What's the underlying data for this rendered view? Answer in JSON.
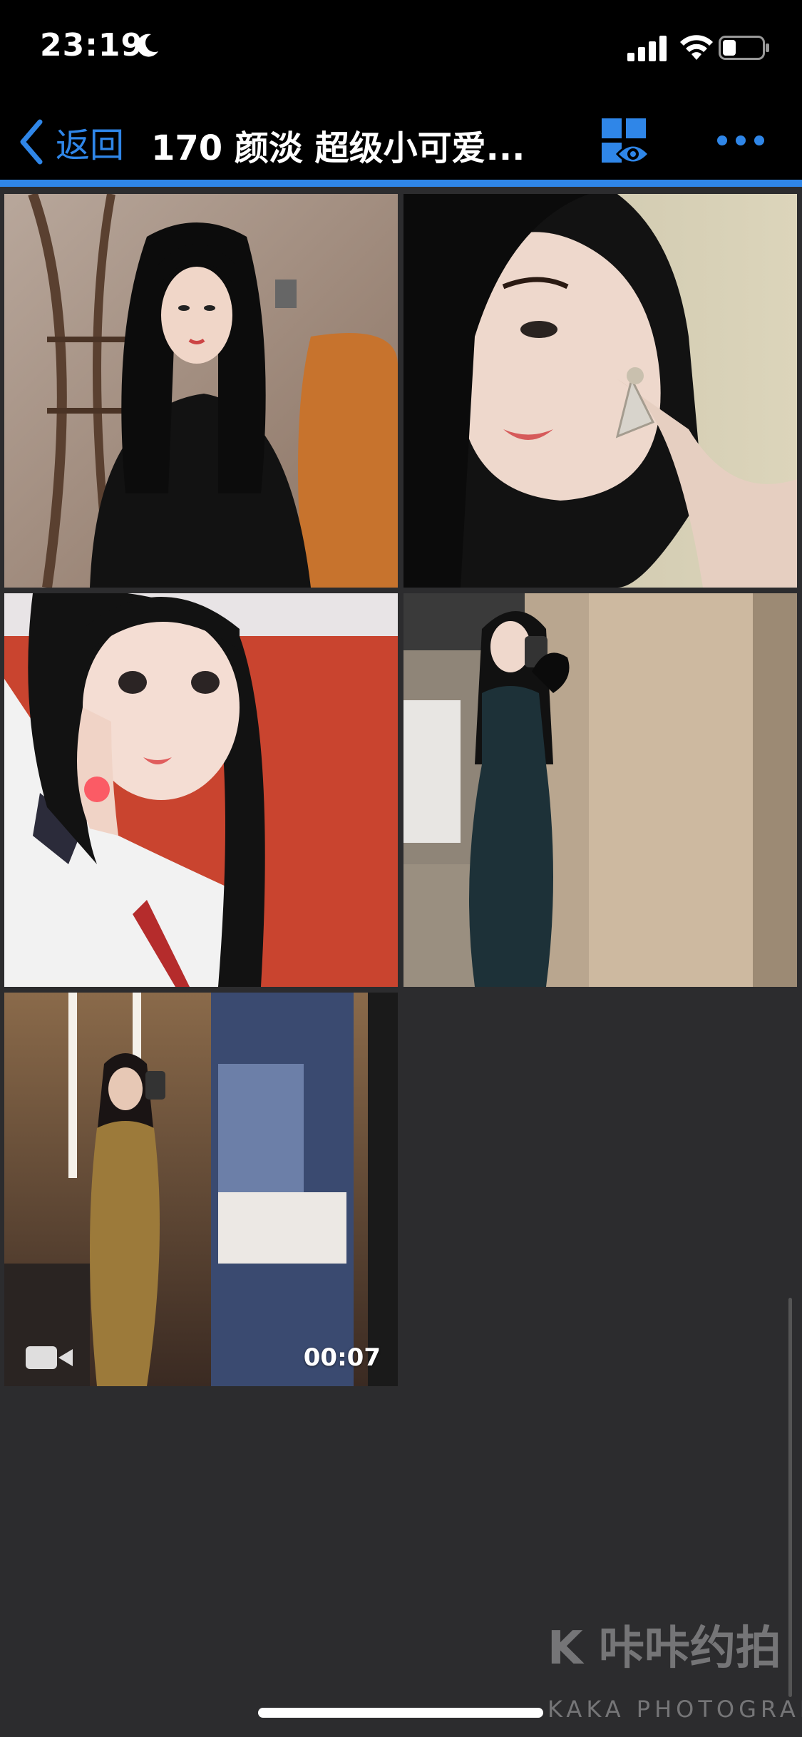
{
  "status_bar": {
    "time": "23:19",
    "icons": [
      "moon-icon",
      "signal-icon",
      "wifi-icon",
      "battery-icon"
    ]
  },
  "nav": {
    "back_label": "返回",
    "title": "170 颜淡 超级小可爱...",
    "icons": [
      "chevron-left-icon",
      "grid-eye-icon",
      "more-icon"
    ],
    "accent_color": "#2f86e8"
  },
  "gallery": {
    "items": [
      {
        "type": "photo"
      },
      {
        "type": "photo"
      },
      {
        "type": "photo"
      },
      {
        "type": "photo"
      },
      {
        "type": "video",
        "duration": "00:07",
        "icon": "video-camera-icon"
      }
    ]
  },
  "watermark": {
    "main": "K 咔咔约拍",
    "sub": "KAKA  PHOTOGRAPH"
  },
  "colors": {
    "background": "#2c2c2e",
    "bar_background": "#000000"
  }
}
